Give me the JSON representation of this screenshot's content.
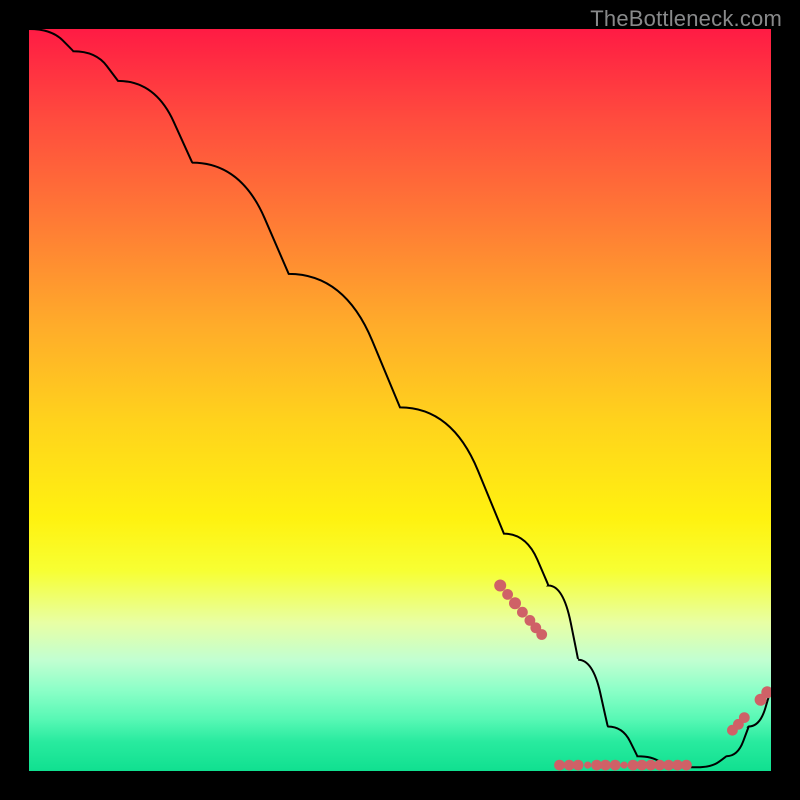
{
  "watermark": "TheBottleneck.com",
  "chart_data": {
    "type": "line",
    "title": "",
    "xlabel": "",
    "ylabel": "",
    "xlim": [
      0,
      100
    ],
    "ylim": [
      0,
      100
    ],
    "background_gradient": {
      "top": "#ff1b44",
      "bottom": "#10e090",
      "description": "vertical red-to-green gradient (bottleneck severity scale)"
    },
    "series": [
      {
        "name": "bottleneck-curve",
        "x": [
          0,
          6,
          12,
          22,
          35,
          50,
          64,
          70,
          74,
          78,
          82,
          86,
          90,
          94,
          97,
          100
        ],
        "y": [
          100,
          97,
          93,
          82,
          67,
          49,
          32,
          25,
          15,
          6,
          2,
          0.5,
          0.5,
          2,
          6,
          11
        ]
      }
    ],
    "markers": [
      {
        "x": 63.5,
        "y": 25.0,
        "r": 1.0
      },
      {
        "x": 64.5,
        "y": 23.8,
        "r": 0.9
      },
      {
        "x": 65.5,
        "y": 22.6,
        "r": 1.0
      },
      {
        "x": 66.5,
        "y": 21.4,
        "r": 0.9
      },
      {
        "x": 67.5,
        "y": 20.3,
        "r": 0.9
      },
      {
        "x": 68.3,
        "y": 19.3,
        "r": 0.9
      },
      {
        "x": 69.1,
        "y": 18.4,
        "r": 0.9
      },
      {
        "x": 71.5,
        "y": 0.8,
        "r": 0.9
      },
      {
        "x": 72.8,
        "y": 0.8,
        "r": 0.9
      },
      {
        "x": 74.0,
        "y": 0.8,
        "r": 0.9
      },
      {
        "x": 75.3,
        "y": 0.8,
        "r": 0.6
      },
      {
        "x": 76.5,
        "y": 0.8,
        "r": 0.9
      },
      {
        "x": 77.7,
        "y": 0.8,
        "r": 0.9
      },
      {
        "x": 79.0,
        "y": 0.8,
        "r": 0.9
      },
      {
        "x": 80.2,
        "y": 0.8,
        "r": 0.6
      },
      {
        "x": 81.4,
        "y": 0.8,
        "r": 0.9
      },
      {
        "x": 82.6,
        "y": 0.8,
        "r": 0.9
      },
      {
        "x": 83.8,
        "y": 0.8,
        "r": 0.9
      },
      {
        "x": 85.0,
        "y": 0.8,
        "r": 0.9
      },
      {
        "x": 86.2,
        "y": 0.8,
        "r": 0.9
      },
      {
        "x": 87.4,
        "y": 0.8,
        "r": 0.9
      },
      {
        "x": 88.6,
        "y": 0.8,
        "r": 0.9
      },
      {
        "x": 94.8,
        "y": 5.5,
        "r": 0.9
      },
      {
        "x": 95.6,
        "y": 6.3,
        "r": 0.9
      },
      {
        "x": 96.4,
        "y": 7.2,
        "r": 0.9
      },
      {
        "x": 98.6,
        "y": 9.6,
        "r": 1.0
      },
      {
        "x": 99.5,
        "y": 10.6,
        "r": 1.0
      }
    ],
    "marker_color": "#cf6167",
    "line_color": "#000000"
  }
}
